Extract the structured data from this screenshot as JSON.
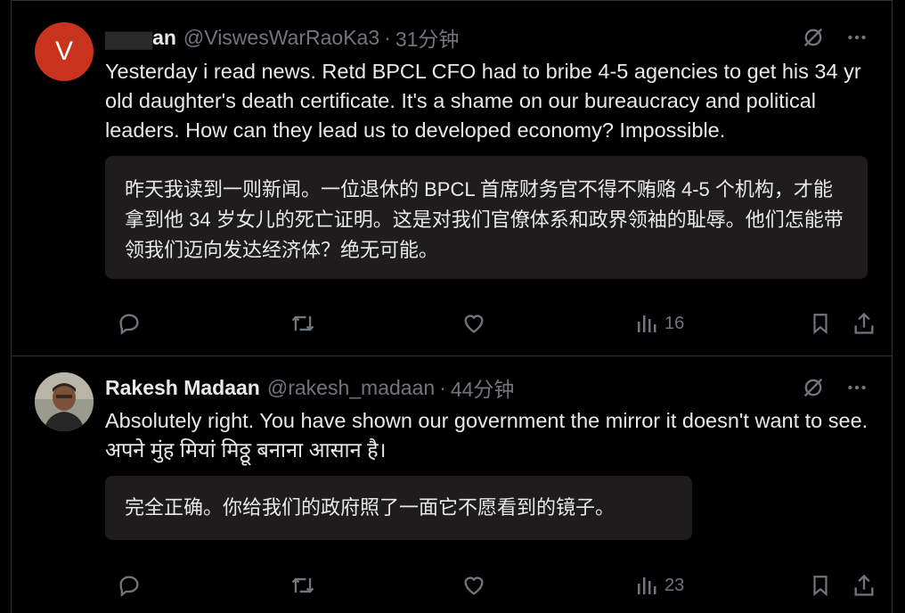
{
  "tweets": [
    {
      "avatar_letter": "V",
      "name": "an",
      "handle": "@ViswesWarRaoKa3",
      "time": "31分钟",
      "text": "Yesterday i read news. Retd BPCL CFO had to bribe 4-5 agencies to get his 34 yr old daughter's death certificate. It's a shame on our bureaucracy and political leaders. How can they lead us to developed economy? Impossible.",
      "translation": "昨天我读到一则新闻。一位退休的 BPCL 首席财务官不得不贿赂 4-5 个机构，才能拿到他 34 岁女儿的死亡证明。这是对我们官僚体系和政界领袖的耻辱。他们怎能带领我们迈向发达经济体？绝无可能。",
      "views": "16"
    },
    {
      "name": "Rakesh Madaan",
      "handle": "@rakesh_madaan",
      "time": "44分钟",
      "text": "Absolutely right. You have shown our government the mirror it doesn't want to see. अपने मुंह मियां मिठ्ठू बनाना आसान है।",
      "translation": "完全正确。你给我们的政府照了一面它不愿看到的镜子。",
      "views": "23"
    }
  ],
  "separator": "·",
  "icons": {
    "hide": "eye-slash-icon",
    "more": "more-icon",
    "reply": "reply-icon",
    "retweet": "retweet-icon",
    "like": "like-icon",
    "views": "views-icon",
    "bookmark": "bookmark-icon",
    "share": "share-icon"
  },
  "colors": {
    "background": "#000000",
    "text": "#e7e9ea",
    "muted": "#71767b",
    "translation_bg": "#1e1c1c",
    "avatar_v": "#c8331d",
    "divider": "#2f3336"
  }
}
